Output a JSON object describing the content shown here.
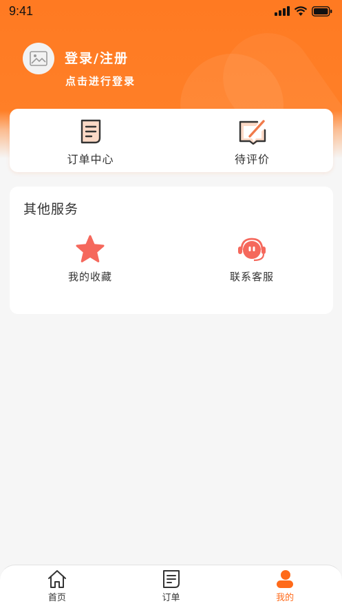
{
  "status_bar": {
    "time": "9:41"
  },
  "header": {
    "login_title": "登录/注册",
    "login_subtitle": "点击进行登录"
  },
  "orders": {
    "items": [
      {
        "label": "订单中心",
        "icon": "order-document-icon"
      },
      {
        "label": "待评价",
        "icon": "review-edit-icon"
      }
    ]
  },
  "services": {
    "title": "其他服务",
    "items": [
      {
        "label": "我的收藏",
        "icon": "star-icon"
      },
      {
        "label": "联系客服",
        "icon": "customer-service-icon"
      }
    ]
  },
  "tabbar": {
    "items": [
      {
        "label": "首页",
        "icon": "home-icon",
        "active": false
      },
      {
        "label": "订单",
        "icon": "order-icon",
        "active": false
      },
      {
        "label": "我的",
        "icon": "profile-icon",
        "active": true
      }
    ]
  },
  "colors": {
    "accent": "#ff6a1a",
    "header_orange": "#ff7a22",
    "star": "#f5685c",
    "icon_fill": "#fbd9c6"
  }
}
